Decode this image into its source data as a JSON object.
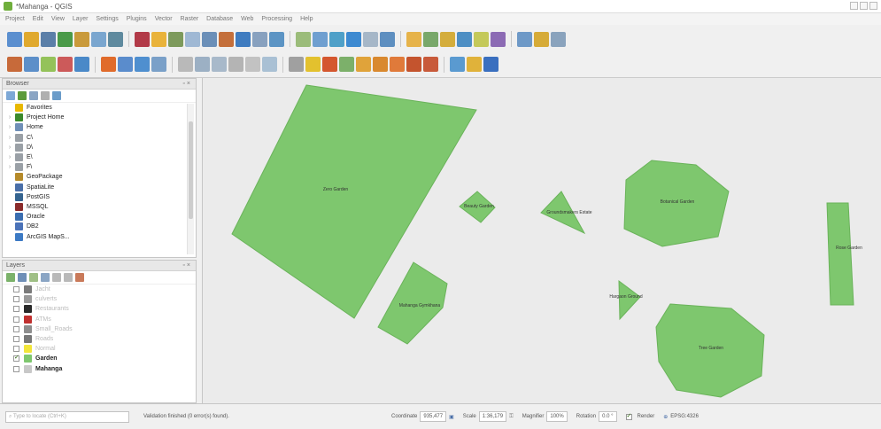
{
  "window": {
    "title": "*Mahanga - QGIS"
  },
  "menubar": {
    "items": [
      "Project",
      "Edit",
      "View",
      "Layer",
      "Settings",
      "Plugins",
      "Vector",
      "Raster",
      "Database",
      "Web",
      "Processing",
      "Help"
    ]
  },
  "browser": {
    "title": "Browser",
    "items": [
      {
        "label": "Favorites",
        "icon": "star-icon",
        "color": "#e8b800",
        "expand": ""
      },
      {
        "label": "Project Home",
        "icon": "folder-icon",
        "color": "#3c8a2c",
        "expand": "›"
      },
      {
        "label": "Home",
        "icon": "home-icon",
        "color": "#6f8fb7",
        "expand": "›"
      },
      {
        "label": "C\\",
        "icon": "drive-icon",
        "color": "#9aa0a6",
        "expand": "›"
      },
      {
        "label": "D\\",
        "icon": "drive-icon",
        "color": "#9aa0a6",
        "expand": "›"
      },
      {
        "label": "E\\",
        "icon": "drive-icon",
        "color": "#9aa0a6",
        "expand": "›"
      },
      {
        "label": "F\\",
        "icon": "drive-icon",
        "color": "#9aa0a6",
        "expand": "›"
      },
      {
        "label": "GeoPackage",
        "icon": "geopackage-icon",
        "color": "#b58a2a",
        "expand": ""
      },
      {
        "label": "SpatiaLite",
        "icon": "spatialite-icon",
        "color": "#4a6fa8",
        "expand": ""
      },
      {
        "label": "PostGIS",
        "icon": "postgis-icon",
        "color": "#34638f",
        "expand": ""
      },
      {
        "label": "MSSQL",
        "icon": "mssql-icon",
        "color": "#8a2b2b",
        "expand": ""
      },
      {
        "label": "Oracle",
        "icon": "oracle-icon",
        "color": "#3a6db0",
        "expand": ""
      },
      {
        "label": "DB2",
        "icon": "db2-icon",
        "color": "#4b72b8",
        "expand": ""
      },
      {
        "label": "ArcGIS MapS...",
        "icon": "arcgis-icon",
        "color": "#3c7ac4",
        "expand": ""
      }
    ]
  },
  "layers": {
    "title": "Layers",
    "items": [
      {
        "label": "Jacht",
        "icon": "line-icon",
        "color": "#7a7a7a",
        "checked": false,
        "style": "faded"
      },
      {
        "label": "culverts",
        "icon": "point-icon",
        "color": "#999999",
        "checked": false,
        "style": "faded"
      },
      {
        "label": "Restaurants",
        "icon": "restaurant-icon",
        "color": "#2a2a2a",
        "checked": false,
        "style": "faded"
      },
      {
        "label": "ATMs",
        "icon": "atm-icon",
        "color": "#c0302f",
        "checked": false,
        "style": "faded"
      },
      {
        "label": "Small_Roads",
        "icon": "line-icon",
        "color": "#8d8d8d",
        "checked": false,
        "style": "faded"
      },
      {
        "label": "Roads",
        "icon": "line-icon",
        "color": "#777777",
        "checked": false,
        "style": "faded"
      },
      {
        "label": "Normal",
        "icon": "polygon-icon",
        "color": "#f1e53a",
        "checked": false,
        "style": "faded"
      },
      {
        "label": "Garden",
        "icon": "polygon-icon",
        "color": "#7ec76e",
        "checked": true,
        "style": "bold"
      },
      {
        "label": "Mahanga",
        "icon": "polygon-icon",
        "color": "#c8c8c8",
        "checked": false,
        "style": "bold"
      }
    ]
  },
  "map": {
    "background": "#ebebeb",
    "fill_color": "#7ec76e",
    "polygons": [
      {
        "label": "Zero Garden"
      },
      {
        "label": "Beauty Garden"
      },
      {
        "label": "Groundsmakers Estate"
      },
      {
        "label": "Botanical Garden"
      },
      {
        "label": "Mahanga Gymkhana"
      },
      {
        "label": "Hargaon Ground"
      },
      {
        "label": "Tree Garden"
      },
      {
        "label": "Rose Garden"
      }
    ]
  },
  "status": {
    "locator_placeholder": "Type to locate (Ctrl+K)",
    "message": "Validation finished (0 error(s) found).",
    "coordinate_label": "Coordinate",
    "coordinate_value": "935,477",
    "scale_label": "Scale",
    "scale_value": "1:36,179",
    "magnifier_label": "Magnifier",
    "magnifier_value": "100%",
    "rotation_label": "Rotation",
    "rotation_value": "0.0 °",
    "render_label": "Render",
    "crs": "EPSG:4326"
  }
}
